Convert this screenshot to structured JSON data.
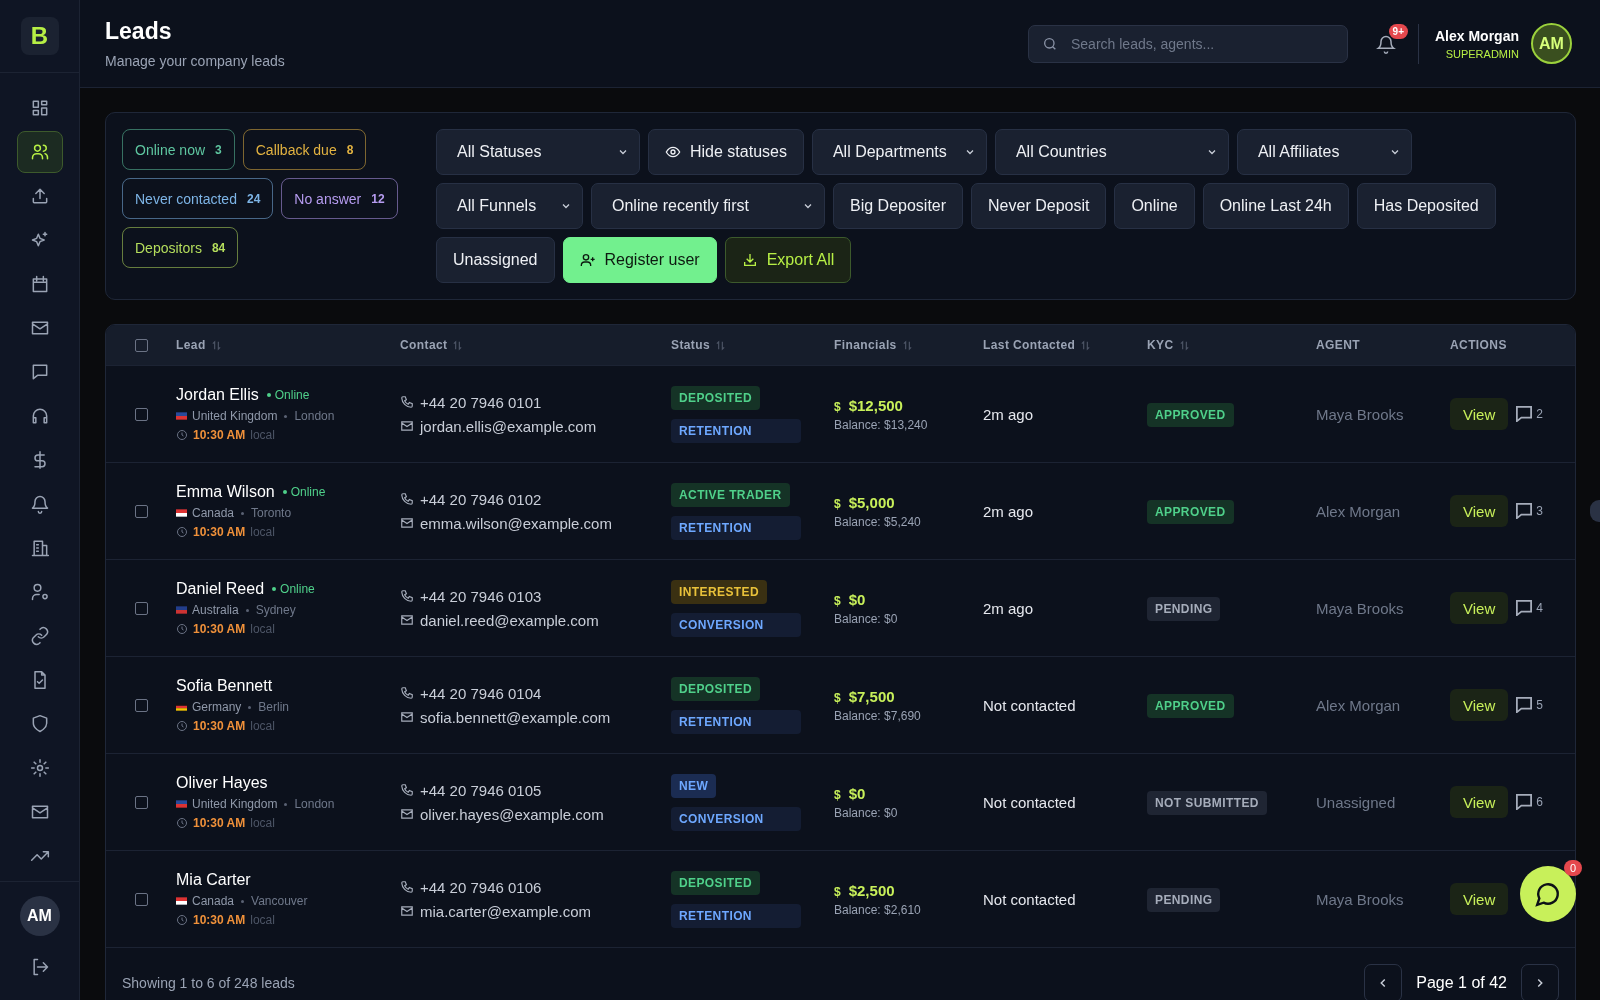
{
  "sidebar": {
    "logo": "B",
    "items": [
      {
        "kind": "dashboard",
        "selected": false
      },
      {
        "kind": "users",
        "selected": true
      },
      {
        "kind": "upload",
        "selected": false
      },
      {
        "kind": "sparkles",
        "selected": false
      },
      {
        "kind": "calendar",
        "selected": false
      },
      {
        "kind": "mail",
        "selected": false
      },
      {
        "kind": "chat",
        "selected": false
      },
      {
        "kind": "headset",
        "selected": false
      },
      {
        "kind": "dollar",
        "selected": false
      },
      {
        "kind": "bell",
        "selected": false
      },
      {
        "kind": "building",
        "selected": false
      },
      {
        "kind": "user-gear",
        "selected": false
      },
      {
        "kind": "link",
        "selected": false
      },
      {
        "kind": "file-check",
        "selected": false
      },
      {
        "kind": "shield",
        "selected": false
      },
      {
        "kind": "gear",
        "selected": false
      },
      {
        "kind": "mail",
        "selected": false
      },
      {
        "kind": "trending",
        "selected": false
      }
    ],
    "avatar": "AM"
  },
  "header": {
    "title": "Leads",
    "subtitle": "Manage your company leads",
    "search": {
      "placeholder": "Search leads, agents..."
    },
    "notifications": "9+",
    "user": {
      "name": "Alex Morgan",
      "role": "SUPERADMIN",
      "initials": "AM"
    }
  },
  "quick_filters": [
    {
      "label": "Online now",
      "count": "3",
      "color": "#5ec6a0"
    },
    {
      "label": "Callback due",
      "count": "8",
      "color": "#e3b341"
    },
    {
      "label": "Never contacted",
      "count": "24",
      "color": "#7db4e6"
    },
    {
      "label": "No answer",
      "count": "12",
      "color": "#b69cf0"
    },
    {
      "label": "Depositors",
      "count": "84",
      "color": "#b5de5c"
    }
  ],
  "filter_rows": [
    [
      {
        "kind": "select",
        "label": "All Statuses"
      },
      {
        "kind": "toggle",
        "label": "Hide statuses"
      },
      {
        "kind": "select",
        "label": "All Departments"
      },
      {
        "kind": "select",
        "label": "All Countries"
      },
      {
        "kind": "select",
        "label": "All Affiliates"
      }
    ],
    [
      {
        "kind": "select",
        "label": "All Funnels"
      },
      {
        "kind": "select",
        "label": "Online recently first"
      },
      {
        "kind": "button",
        "label": "Big Depositer"
      },
      {
        "kind": "button",
        "label": "Never Deposit"
      },
      {
        "kind": "button",
        "label": "Online"
      },
      {
        "kind": "button",
        "label": "Online Last 24h"
      },
      {
        "kind": "button",
        "label": "Has Deposited"
      }
    ],
    [
      {
        "kind": "button",
        "label": "Unassigned"
      },
      {
        "kind": "primary",
        "label": "Register user"
      },
      {
        "kind": "export",
        "label": "Export All"
      }
    ]
  ],
  "table": {
    "select_all": {
      "checked": false
    },
    "columns": [
      {
        "label": "Lead",
        "sortable": true
      },
      {
        "label": "Contact",
        "sortable": true
      },
      {
        "label": "Status",
        "sortable": true
      },
      {
        "label": "Financials",
        "sortable": true
      },
      {
        "label": "Last Contacted",
        "sortable": true
      },
      {
        "label": "KYC",
        "sortable": true
      },
      {
        "label": "AGENT",
        "sortable": false
      },
      {
        "label": "ACTIONS",
        "sortable": false
      }
    ],
    "rows": [
      {
        "checked": false,
        "name": "Jordan Ellis",
        "presence": "Online",
        "flag": {
          "kind": "uk"
        },
        "country": "United Kingdom",
        "city": "London",
        "time": "10:30 AM",
        "time_suffix": "local",
        "phone": "+44 20 7946 0101",
        "email": "jordan.ellis@example.com",
        "status": {
          "label": "DEPOSITED",
          "kind": "green"
        },
        "pipeline": {
          "label": "RETENTION",
          "kind": "blue"
        },
        "currency": "$",
        "amount": "$12,500",
        "balance": "Balance: $13,240",
        "last_contacted": "2m ago",
        "kyc": {
          "label": "APPROVED",
          "kind": "green"
        },
        "agent": "Maya Brooks",
        "action": "View",
        "comments": "2"
      },
      {
        "checked": false,
        "name": "Emma Wilson",
        "presence": "Online",
        "flag": {
          "kind": "ca"
        },
        "country": "Canada",
        "city": "Toronto",
        "time": "10:30 AM",
        "time_suffix": "local",
        "phone": "+44 20 7946 0102",
        "email": "emma.wilson@example.com",
        "status": {
          "label": "ACTIVE TRADER",
          "kind": "green"
        },
        "pipeline": {
          "label": "RETENTION",
          "kind": "blue"
        },
        "currency": "$",
        "amount": "$5,000",
        "balance": "Balance: $5,240",
        "last_contacted": "2m ago",
        "kyc": {
          "label": "APPROVED",
          "kind": "green"
        },
        "agent": "Alex Morgan",
        "action": "View",
        "comments": "3"
      },
      {
        "checked": false,
        "name": "Daniel Reed",
        "presence": "Online",
        "flag": {
          "kind": "au"
        },
        "country": "Australia",
        "city": "Sydney",
        "time": "10:30 AM",
        "time_suffix": "local",
        "phone": "+44 20 7946 0103",
        "email": "daniel.reed@example.com",
        "status": {
          "label": "INTERESTED",
          "kind": "yellow"
        },
        "pipeline": {
          "label": "CONVERSION",
          "kind": "blue"
        },
        "currency": "$",
        "amount": "$0",
        "balance": "Balance: $0",
        "last_contacted": "2m ago",
        "kyc": {
          "label": "PENDING",
          "kind": "grey"
        },
        "agent": "Maya Brooks",
        "action": "View",
        "comments": "4"
      },
      {
        "checked": false,
        "name": "Sofia Bennett",
        "flag": {
          "kind": "de"
        },
        "country": "Germany",
        "city": "Berlin",
        "time": "10:30 AM",
        "time_suffix": "local",
        "phone": "+44 20 7946 0104",
        "email": "sofia.bennett@example.com",
        "status": {
          "label": "DEPOSITED",
          "kind": "green"
        },
        "pipeline": {
          "label": "RETENTION",
          "kind": "blue"
        },
        "currency": "$",
        "amount": "$7,500",
        "balance": "Balance: $7,690",
        "last_contacted": "Not contacted",
        "kyc": {
          "label": "APPROVED",
          "kind": "green"
        },
        "agent": "Alex Morgan",
        "action": "View",
        "comments": "5"
      },
      {
        "checked": false,
        "name": "Oliver Hayes",
        "flag": {
          "kind": "uk"
        },
        "country": "United Kingdom",
        "city": "London",
        "time": "10:30 AM",
        "time_suffix": "local",
        "phone": "+44 20 7946 0105",
        "email": "oliver.hayes@example.com",
        "status": {
          "label": "NEW",
          "kind": "navy"
        },
        "pipeline": {
          "label": "CONVERSION",
          "kind": "blue"
        },
        "currency": "$",
        "amount": "$0",
        "balance": "Balance: $0",
        "last_contacted": "Not contacted",
        "kyc": {
          "label": "NOT SUBMITTED",
          "kind": "grey"
        },
        "agent": "Unassigned",
        "action": "View",
        "comments": "6"
      },
      {
        "checked": false,
        "name": "Mia Carter",
        "flag": {
          "kind": "ca"
        },
        "country": "Canada",
        "city": "Vancouver",
        "time": "10:30 AM",
        "time_suffix": "local",
        "phone": "+44 20 7946 0106",
        "email": "mia.carter@example.com",
        "status": {
          "label": "DEPOSITED",
          "kind": "green"
        },
        "pipeline": {
          "label": "RETENTION",
          "kind": "blue"
        },
        "currency": "$",
        "amount": "$2,500",
        "balance": "Balance: $2,610",
        "last_contacted": "Not contacted",
        "kyc": {
          "label": "PENDING",
          "kind": "grey"
        },
        "agent": "Maya Brooks",
        "action": "View"
      }
    ]
  },
  "footer": {
    "summary": "Showing 1 to 6 of 248 leads",
    "page": "Page 1 of 42"
  },
  "chat_button": {
    "badge": "0"
  }
}
